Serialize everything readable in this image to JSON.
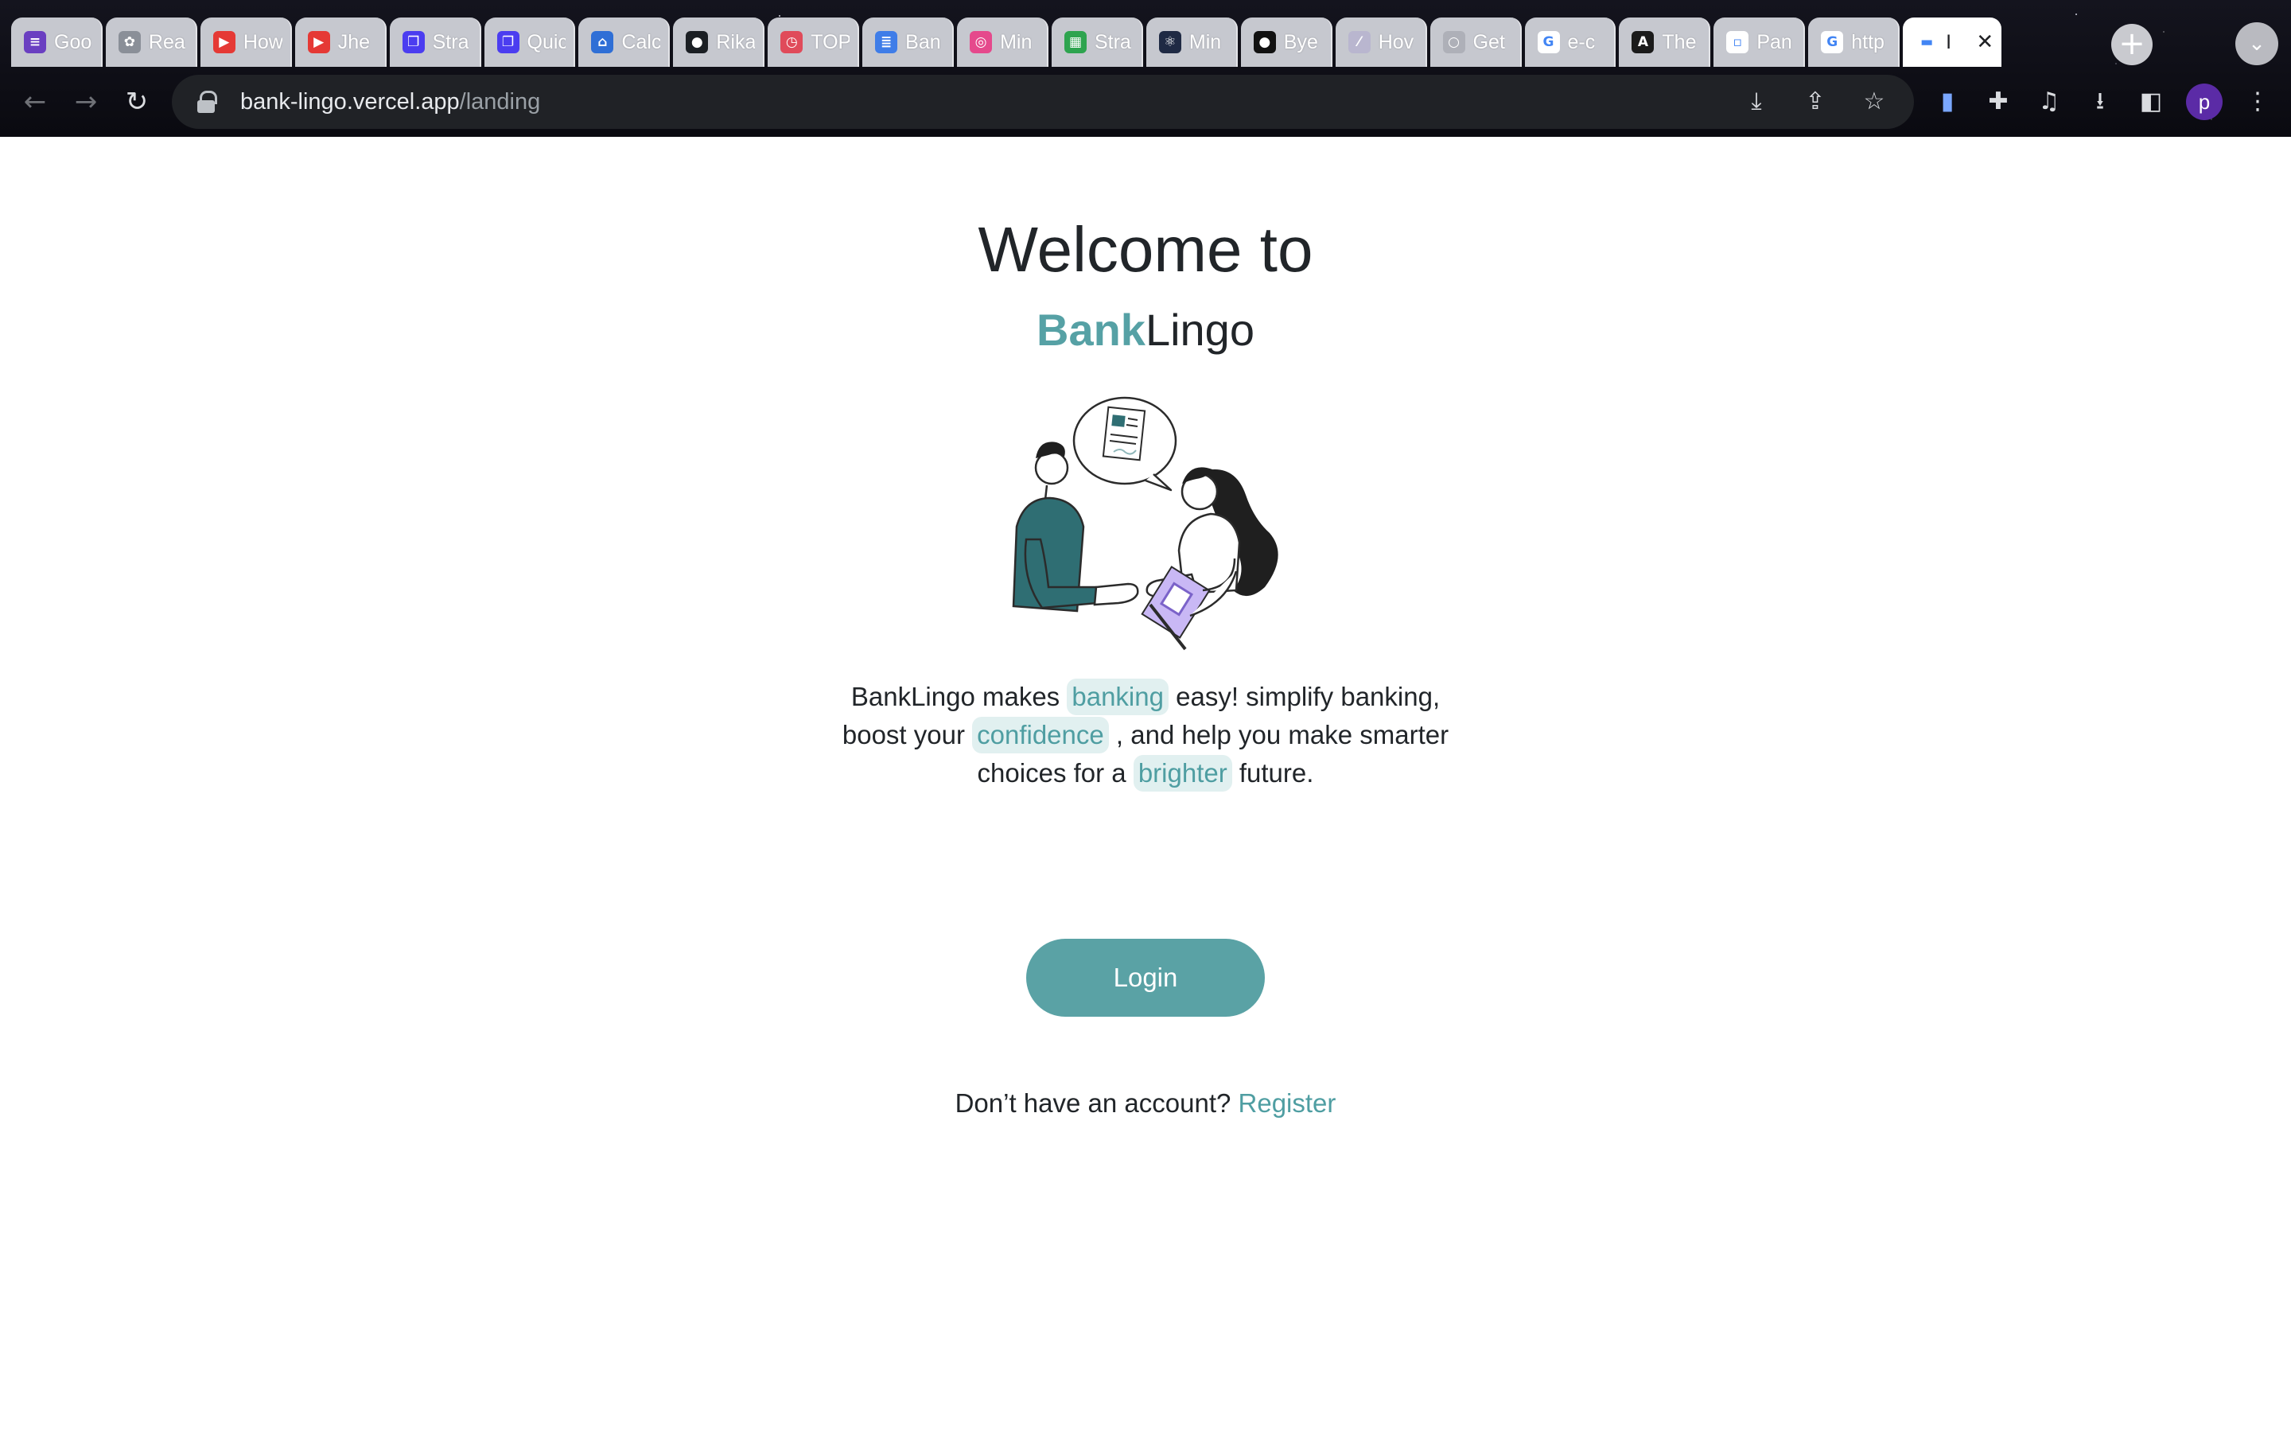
{
  "browser": {
    "tabs": [
      {
        "title": "Goo",
        "favicon": "google-forms-icon",
        "color": "#6a3fc1",
        "glyph": "≡"
      },
      {
        "title": "Rea",
        "favicon": "openai-icon",
        "color": "#8a8f98",
        "glyph": "✿"
      },
      {
        "title": "How",
        "favicon": "youtube-icon",
        "color": "#e53935",
        "glyph": "▶"
      },
      {
        "title": "Jhe",
        "favicon": "youtube-icon",
        "color": "#e53935",
        "glyph": "▶"
      },
      {
        "title": "Stra",
        "favicon": "app-icon",
        "color": "#4b3df0",
        "glyph": "❐"
      },
      {
        "title": "Quic",
        "favicon": "app-icon",
        "color": "#4b3df0",
        "glyph": "❐"
      },
      {
        "title": "Calc",
        "favicon": "calculator-icon",
        "color": "#2f6fd6",
        "glyph": "⌂"
      },
      {
        "title": "Rika",
        "favicon": "github-icon",
        "color": "#1b1f24",
        "glyph": "●"
      },
      {
        "title": "TOP",
        "favicon": "timer-icon",
        "color": "#e04b5a",
        "glyph": "◷"
      },
      {
        "title": "Ban",
        "favicon": "google-docs-icon",
        "color": "#3f7de8",
        "glyph": "≣"
      },
      {
        "title": "Min",
        "favicon": "dribbble-icon",
        "color": "#e5498c",
        "glyph": "◎"
      },
      {
        "title": "Stra",
        "favicon": "sheets-icon",
        "color": "#2ea44f",
        "glyph": "▦"
      },
      {
        "title": "Min",
        "favicon": "react-icon",
        "color": "#1f2a44",
        "glyph": "⚛"
      },
      {
        "title": "Bye",
        "favicon": "medium-icon",
        "color": "#111111",
        "glyph": "●"
      },
      {
        "title": "Hov",
        "favicon": "generic-page-icon",
        "color": "#b9b6cf",
        "glyph": "⁄"
      },
      {
        "title": "Get",
        "favicon": "generic-page-icon",
        "color": "#aeb0b8",
        "glyph": "○"
      },
      {
        "title": "e-c",
        "favicon": "google-icon",
        "color": "#ffffff",
        "glyph": "G"
      },
      {
        "title": "The",
        "favicon": "angular-icon",
        "color": "#1b1b1b",
        "glyph": "A"
      },
      {
        "title": "Pan",
        "favicon": "generic-page-icon",
        "color": "#ffffff",
        "glyph": "▫"
      },
      {
        "title": "http",
        "favicon": "google-icon",
        "color": "#ffffff",
        "glyph": "G"
      },
      {
        "title": "I",
        "favicon": "bank-lingo-icon",
        "color": "#ffffff",
        "glyph": "▬",
        "active": true
      }
    ],
    "new_tab_label": "+",
    "tab_search_label": "⌄",
    "url_host": "bank-lingo.vercel.app",
    "url_path": "/landing",
    "profile_initial": "p"
  },
  "page": {
    "welcome": "Welcome to",
    "brand_bank": "Bank",
    "brand_lingo": "Lingo",
    "tagline": {
      "p1": "BankLingo makes ",
      "chip1": "banking",
      "p2": " easy! simplify banking, boost your ",
      "chip2": "confidence",
      "p3": " , and help you make smarter choices for a ",
      "chip3": "brighter",
      "p4": " future."
    },
    "login_label": "Login",
    "register_prompt": "Don’t have an account? ",
    "register_link": "Register"
  },
  "colors": {
    "accent": "#5aa2a5",
    "chip_bg": "#e1f0f0",
    "text": "#212529"
  }
}
